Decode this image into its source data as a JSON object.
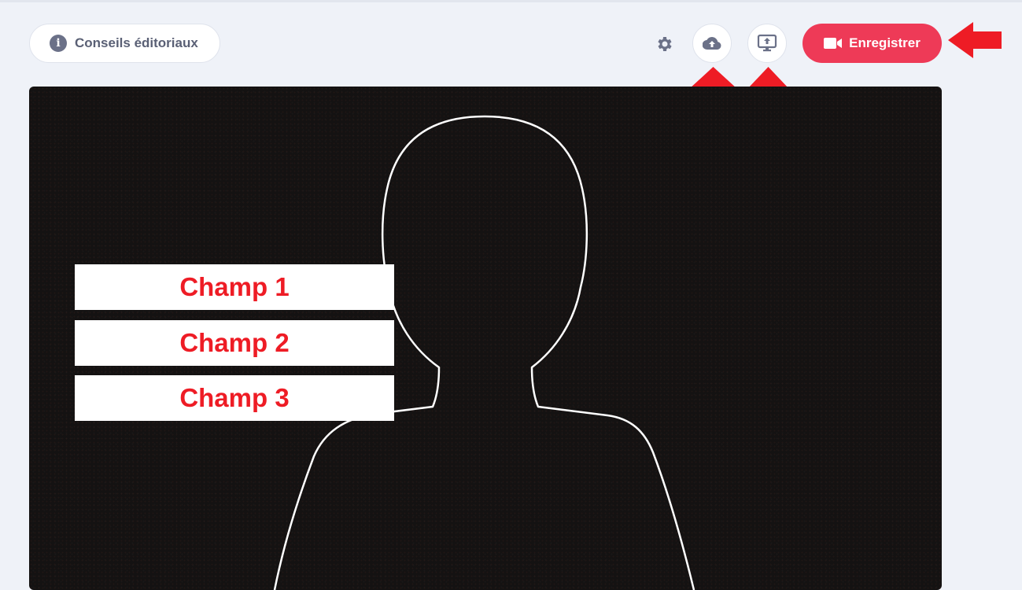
{
  "toolbar": {
    "tips_label": "Conseils éditoriaux",
    "record_label": "Enregistrer",
    "icons": {
      "info": "info-icon",
      "settings": "gear-icon",
      "upload": "cloud-upload-icon",
      "screen_share": "screen-share-icon",
      "record": "video-camera-icon"
    }
  },
  "preview": {
    "fields": [
      "Champ 1",
      "Champ 2",
      "Champ 3"
    ]
  },
  "colors": {
    "accent": "#ee3a57",
    "annotation_arrow": "#ee1c25",
    "background": "#eff2f8",
    "preview_bg": "#141212",
    "field_text": "#ee1c25"
  }
}
